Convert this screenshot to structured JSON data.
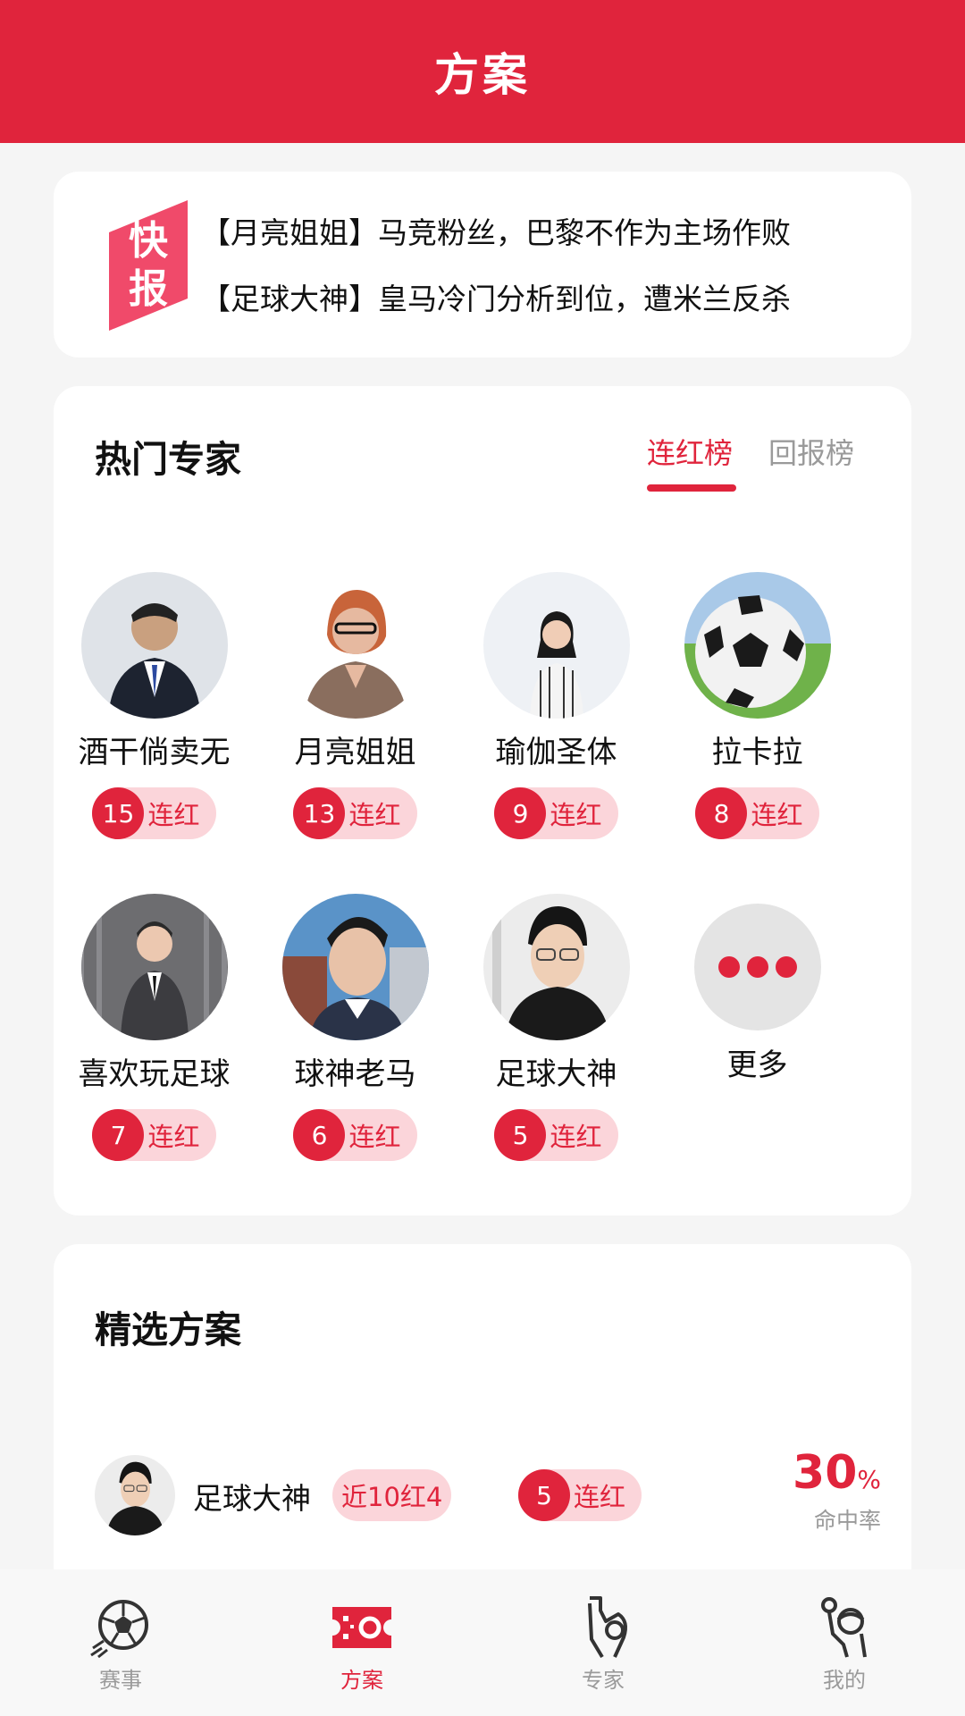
{
  "header": {
    "title": "方案"
  },
  "news": {
    "logo_text": "快报",
    "items": [
      "【月亮姐姐】马竞粉丝，巴黎不作为主场作败",
      "【足球大神】皇马冷门分析到位，遭米兰反杀"
    ]
  },
  "experts": {
    "title": "热门专家",
    "tabs": [
      "连红榜",
      "回报榜"
    ],
    "active_tab": "连红榜",
    "list": [
      {
        "name": "酒干倘卖无",
        "streak": "15",
        "streak_label": "连红"
      },
      {
        "name": "月亮姐姐",
        "streak": "13",
        "streak_label": "连红"
      },
      {
        "name": "瑜伽圣体",
        "streak": "9",
        "streak_label": "连红"
      },
      {
        "name": "拉卡拉",
        "streak": "8",
        "streak_label": "连红"
      },
      {
        "name": "喜欢玩足球",
        "streak": "7",
        "streak_label": "连红"
      },
      {
        "name": "球神老马",
        "streak": "6",
        "streak_label": "连红"
      },
      {
        "name": "足球大神",
        "streak": "5",
        "streak_label": "连红"
      }
    ],
    "more_label": "更多"
  },
  "picks": {
    "title": "精选方案",
    "items": [
      {
        "name": "足球大神",
        "recent": "近10红4",
        "streak": "5",
        "streak_label": "连红",
        "hit_rate": "30",
        "hit_rate_unit": "%",
        "hit_rate_label": "命中率"
      }
    ]
  },
  "tabbar": {
    "items": [
      "赛事",
      "方案",
      "专家",
      "我的"
    ],
    "active": "方案"
  },
  "colors": {
    "accent": "#e0243c",
    "accent_light": "#fbd5da",
    "background": "#f5f5f5"
  }
}
